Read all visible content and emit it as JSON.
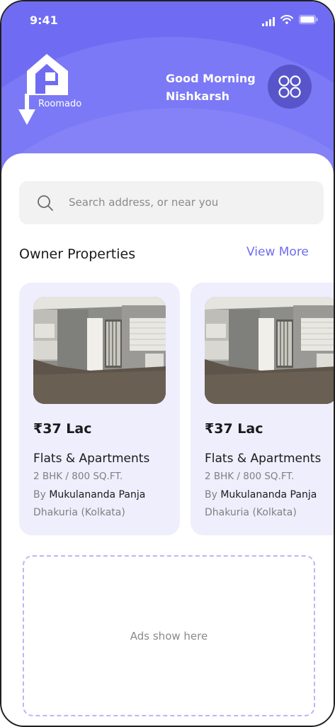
{
  "status_bar": {
    "time": "9:41"
  },
  "brand": {
    "name": "Roomado"
  },
  "header": {
    "greeting_line1": "Good Morning",
    "greeting_line2": "Nishkarsh"
  },
  "search": {
    "placeholder": "Search address, or near you"
  },
  "section": {
    "title": "Owner Properties",
    "view_more": "View More"
  },
  "properties": [
    {
      "price": "₹37 Lac",
      "type": "Flats & Apartments",
      "size": "2 BHK / 800 SQ.FT.",
      "by_prefix": "By",
      "owner": "Mukulananda Panja",
      "location": "Dhakuria (Kolkata)"
    },
    {
      "price": "₹37 Lac",
      "type": "Flats & Apartments",
      "size": "2 BHK / 800 SQ.FT.",
      "by_prefix": "By",
      "owner": "Mukulananda Panja",
      "location": "Dhakuria (Kolkata)"
    }
  ],
  "ads": {
    "label": "Ads show here"
  },
  "colors": {
    "accent": "#6f6cf3",
    "card_bg": "#efeefd",
    "menu_button": "#5755c9"
  },
  "icons": [
    "signal-icon",
    "wifi-icon",
    "battery-icon",
    "roomado-logo",
    "grid-menu-icon",
    "search-icon"
  ]
}
